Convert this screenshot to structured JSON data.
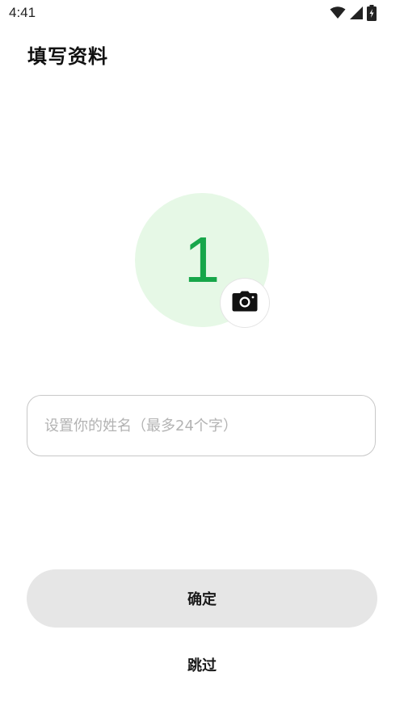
{
  "status_bar": {
    "time": "4:41",
    "icons": [
      "wifi-icon",
      "cell-signal-icon",
      "battery-charging-icon"
    ]
  },
  "page": {
    "title": "填写资料"
  },
  "avatar": {
    "initial": "1",
    "background_color": "#e6f8e6",
    "initial_color": "#17a64a",
    "camera_icon": "camera-icon"
  },
  "name_input": {
    "value": "",
    "placeholder": "设置你的姓名（最多24个字）"
  },
  "actions": {
    "confirm_label": "确定",
    "skip_label": "跳过"
  }
}
